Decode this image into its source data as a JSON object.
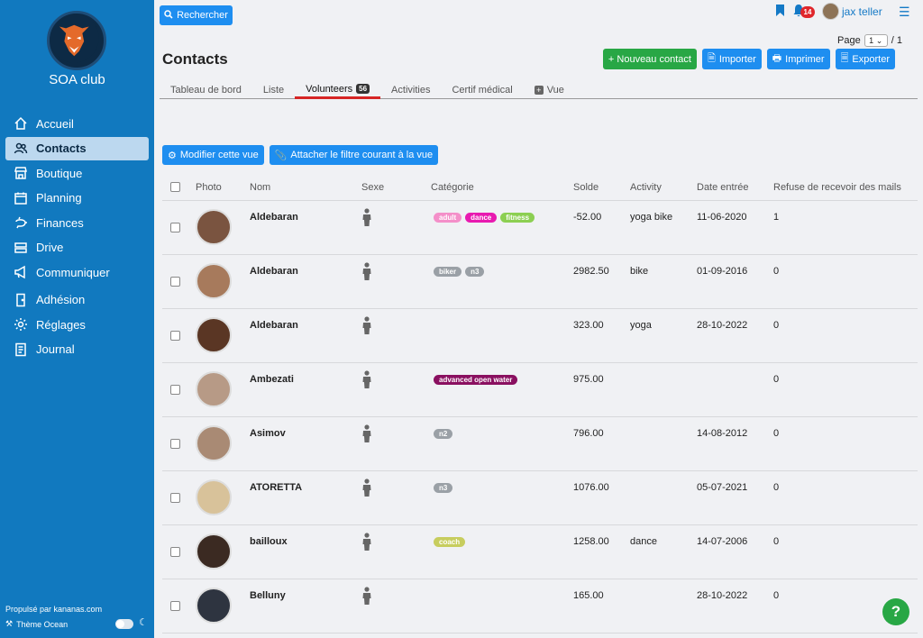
{
  "sidebar": {
    "club_name": "SOA club",
    "items": [
      {
        "label": "Accueil",
        "icon": "home-icon"
      },
      {
        "label": "Contacts",
        "icon": "users-icon",
        "active": true
      },
      {
        "label": "Boutique",
        "icon": "shop-icon"
      },
      {
        "label": "Planning",
        "icon": "calendar-icon"
      },
      {
        "label": "Finances",
        "icon": "piggy-bank-icon"
      },
      {
        "label": "Drive",
        "icon": "drive-icon"
      },
      {
        "label": "Communiquer",
        "icon": "megaphone-icon"
      },
      {
        "label": "Adhésion",
        "icon": "door-icon"
      },
      {
        "label": "Réglages",
        "icon": "gear-icon"
      },
      {
        "label": "Journal",
        "icon": "journal-icon"
      }
    ],
    "powered_by": "Propulsé par kananas.com",
    "theme_label": "Thème Ocean"
  },
  "topbar": {
    "search_label": "Rechercher",
    "notification_count": "14",
    "user_name": "jax teller"
  },
  "pagination": {
    "label": "Page",
    "current": "1",
    "total": "/ 1"
  },
  "page_title": "Contacts",
  "actions": {
    "new_contact": "+ Nouveau contact",
    "import": "Importer",
    "print": "Imprimer",
    "export": "Exporter"
  },
  "tabs": [
    {
      "label": "Tableau de bord"
    },
    {
      "label": "Liste"
    },
    {
      "label": "Volunteers",
      "badge": "56",
      "active": true
    },
    {
      "label": "Activities"
    },
    {
      "label": "Certif médical"
    },
    {
      "label": "Vue"
    }
  ],
  "view_actions": {
    "modify_view": "Modifier cette vue",
    "attach_filter": "Attacher le filtre courant à la vue"
  },
  "table": {
    "headers": {
      "photo": "Photo",
      "name": "Nom",
      "gender": "Sexe",
      "category": "Catégorie",
      "balance": "Solde",
      "activity": "Activity",
      "entry_date": "Date entrée",
      "refuse_mails": "Refuse de recevoir des mails"
    },
    "rows": [
      {
        "name": "Aldebaran",
        "tags": [
          {
            "t": "adult",
            "c": "#f48fc9"
          },
          {
            "t": "dance",
            "c": "#e81ab0"
          },
          {
            "t": "fitness",
            "c": "#8ccf52"
          }
        ],
        "balance": "-52.00",
        "activity": "yoga bike",
        "date": "11-06-2020",
        "refuse": "1",
        "avatar": "#7a5440"
      },
      {
        "name": "Aldebaran",
        "tags": [
          {
            "t": "biker",
            "c": "#9aa0a6"
          },
          {
            "t": "n3",
            "c": "#9aa0a6"
          }
        ],
        "balance": "2982.50",
        "activity": "bike",
        "date": "01-09-2016",
        "refuse": "0",
        "avatar": "#a77a5c"
      },
      {
        "name": "Aldebaran",
        "tags": [],
        "balance": "323.00",
        "activity": "yoga",
        "date": "28-10-2022",
        "refuse": "0",
        "avatar": "#5a3624"
      },
      {
        "name": "Ambezati",
        "tags": [
          {
            "t": "advanced open water",
            "c": "#8a1060"
          }
        ],
        "balance": "975.00",
        "activity": "",
        "date": "",
        "refuse": "0",
        "avatar": "#b79a86"
      },
      {
        "name": "Asimov",
        "tags": [
          {
            "t": "n2",
            "c": "#9aa0a6"
          }
        ],
        "balance": "796.00",
        "activity": "",
        "date": "14-08-2012",
        "refuse": "0",
        "avatar": "#a98a74"
      },
      {
        "name": "ATORETTA",
        "tags": [
          {
            "t": "n3",
            "c": "#9aa0a6"
          }
        ],
        "balance": "1076.00",
        "activity": "",
        "date": "05-07-2021",
        "refuse": "0",
        "avatar": "#d8c29a"
      },
      {
        "name": "bailloux",
        "tags": [
          {
            "t": "coach",
            "c": "#c7cd5e"
          }
        ],
        "balance": "1258.00",
        "activity": "dance",
        "date": "14-07-2006",
        "refuse": "0",
        "avatar": "#3b2a22"
      },
      {
        "name": "Belluny",
        "tags": [],
        "balance": "165.00",
        "activity": "",
        "date": "28-10-2022",
        "refuse": "0",
        "avatar": "#2e3440"
      }
    ]
  },
  "colors": {
    "sidebar": "#1179bf",
    "primary": "#1e8ef0",
    "success": "#28a745",
    "active_tab": "#d62525"
  }
}
